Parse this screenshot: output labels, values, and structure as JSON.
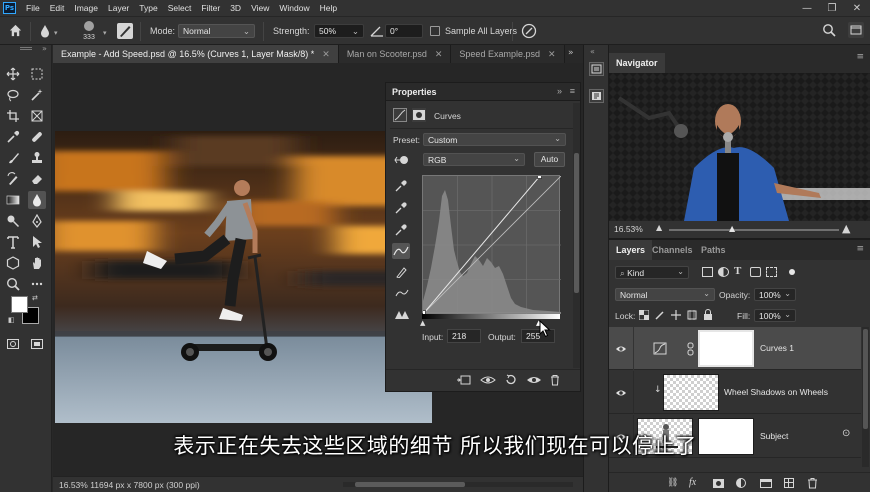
{
  "menu": {
    "app_logo": "Ps",
    "items": [
      "File",
      "Edit",
      "Image",
      "Layer",
      "Type",
      "Select",
      "Filter",
      "3D",
      "View",
      "Window",
      "Help"
    ]
  },
  "options_bar": {
    "brush_size": "333",
    "mode_label": "Mode:",
    "mode_value": "Normal",
    "strength_label": "Strength:",
    "strength_value": "50%",
    "angle_value": "0°",
    "sample_all_layers": "Sample All Layers"
  },
  "document_tabs": [
    {
      "label": "Example - Add Speed.psd @ 16.5% (Curves 1, Layer Mask/8) *",
      "active": true
    },
    {
      "label": "Man on Scooter.psd",
      "active": false
    },
    {
      "label": "Speed Example.psd",
      "active": false
    }
  ],
  "status_bar": {
    "text": "16.53% 11694 px x 7800 px (300 ppi)"
  },
  "properties": {
    "title": "Properties",
    "adjustment_name": "Curves",
    "preset_label": "Preset:",
    "preset_value": "Custom",
    "channel_value": "RGB",
    "auto_label": "Auto",
    "input_label": "Input:",
    "input_value": "218",
    "output_label": "Output:",
    "output_value": "255"
  },
  "navigator": {
    "title": "Navigator",
    "zoom": "16.53%"
  },
  "layers_panel": {
    "tabs": [
      "Layers",
      "Channels",
      "Paths"
    ],
    "filter_kind": "Kind",
    "blend_mode": "Normal",
    "opacity_label": "Opacity:",
    "opacity_value": "100%",
    "lock_label": "Lock:",
    "fill_label": "Fill:",
    "fill_value": "100%",
    "layers": [
      {
        "name": "Curves 1",
        "selected": true
      },
      {
        "name": "Wheel Shadows on Wheels",
        "selected": false
      },
      {
        "name": "Subject",
        "selected": false
      }
    ]
  },
  "subtitle": "表示正在失去这些区域的细节 所以我们现在可以停止了",
  "colors": {
    "ui_dark": "#323232",
    "ui_darker": "#282828",
    "accent": "#31a8ff",
    "selected_row": "#4b4b4b"
  }
}
